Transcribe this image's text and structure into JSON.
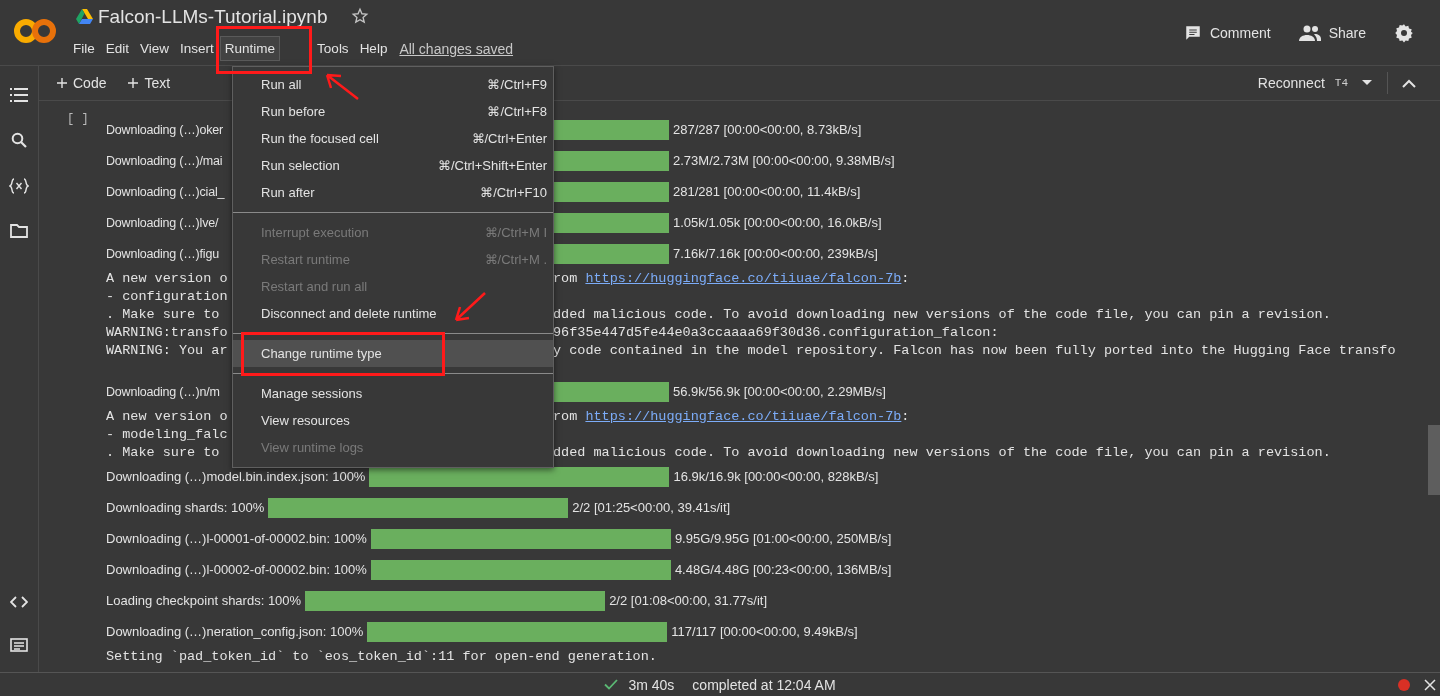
{
  "header": {
    "title": "Falcon-LLMs-Tutorial.ipynb",
    "save_status": "All changes saved",
    "actions": [
      {
        "kind": "comment",
        "label": "Comment"
      },
      {
        "kind": "share",
        "label": "Share"
      }
    ]
  },
  "menubar": [
    {
      "label": "File",
      "selected": false
    },
    {
      "label": "Edit",
      "selected": false
    },
    {
      "label": "View",
      "selected": false
    },
    {
      "label": "Insert",
      "selected": false
    },
    {
      "label": "Runtime",
      "selected": true
    },
    {
      "label": "Tools",
      "selected": false
    },
    {
      "label": "Help",
      "selected": false
    }
  ],
  "toolbar": {
    "add_buttons": [
      "Code",
      "Text"
    ],
    "runtime": {
      "label": "Reconnect",
      "accelerator": "T4"
    }
  },
  "cell": {
    "gutter": "[ ]",
    "lines": [
      {
        "kind": "progress",
        "under_menu": true,
        "label": "Downloading (…)oker",
        "level": 1,
        "reading": "287/287 [00:00<00:00, 8.73kB/s]"
      },
      {
        "kind": "progress",
        "under_menu": true,
        "label": "Downloading (…)/mai",
        "level": 1,
        "reading": "2.73M/2.73M [00:00<00:00, 9.38MB/s]"
      },
      {
        "kind": "progress",
        "under_menu": true,
        "label": "Downloading (…)cial_",
        "level": 1,
        "reading": "281/281 [00:00<00:00, 11.4kB/s]"
      },
      {
        "kind": "progress",
        "under_menu": true,
        "label": "Downloading (…)lve/",
        "level": 1,
        "reading": "1.05k/1.05k [00:00<00:00, 16.0kB/s]"
      },
      {
        "kind": "progress",
        "under_menu": true,
        "label": "Downloading (…)figu",
        "level": 1,
        "reading": "7.16k/7.16k [00:00<00:00, 239kB/s]"
      },
      {
        "kind": "text",
        "under_menu": true,
        "text": "A new version o",
        "right": [
          {
            "text": "rom "
          },
          {
            "text": "https://huggingface.co/tiiuae/falcon-7b",
            "kind": "link"
          },
          {
            "text": ":"
          }
        ]
      },
      {
        "kind": "text",
        "under_menu": true,
        "text": "- configuration"
      },
      {
        "kind": "text",
        "under_menu": true,
        "text": ". Make sure to",
        "right": [
          {
            "text": "dded malicious code. To avoid downloading new versions of the code file, you can pin a revision."
          }
        ]
      },
      {
        "kind": "text",
        "under_menu": true,
        "text": "WARNING:transfo",
        "right": [
          {
            "text": "96f35e447d5fe44e0a3ccaaaa69f30d36.configuration_falcon:"
          }
        ]
      },
      {
        "kind": "text",
        "under_menu": true,
        "text": "WARNING: You ar",
        "right": [
          {
            "text": "y code contained in the model repository. Falcon has now been fully ported into the Hugging Face transfo"
          }
        ]
      },
      {
        "kind": "blank"
      },
      {
        "kind": "progress",
        "under_menu": true,
        "label": "Downloading (…)n/m",
        "level": 1,
        "reading": "56.9k/56.9k [00:00<00:00, 2.29MB/s]"
      },
      {
        "kind": "text",
        "under_menu": true,
        "text": "A new version o",
        "right": [
          {
            "text": "rom "
          },
          {
            "text": "https://huggingface.co/tiiuae/falcon-7b",
            "kind": "link"
          },
          {
            "text": ":"
          }
        ]
      },
      {
        "kind": "text",
        "under_menu": true,
        "text": "- modeling_falc"
      },
      {
        "kind": "text",
        "under_menu": true,
        "text": ". Make sure to",
        "right": [
          {
            "text": "dded malicious code. To avoid downloading new versions of the code file, you can pin a revision."
          }
        ]
      },
      {
        "kind": "progress",
        "under_menu": false,
        "label": "Downloading (…)model.bin.index.json: 100%",
        "level": 1,
        "reading": "16.9k/16.9k [00:00<00:00, 828kB/s]"
      },
      {
        "kind": "progress",
        "under_menu": false,
        "label": "Downloading shards: 100%",
        "level": 1,
        "reading": "2/2 [01:25<00:00, 39.41s/it]"
      },
      {
        "kind": "progress",
        "under_menu": false,
        "label": "Downloading (…)l-00001-of-00002.bin: 100%",
        "level": 1,
        "reading": "9.95G/9.95G [01:00<00:00, 250MB/s]"
      },
      {
        "kind": "progress",
        "under_menu": false,
        "label": "Downloading (…)l-00002-of-00002.bin: 100%",
        "level": 1,
        "reading": "4.48G/4.48G [00:23<00:00, 136MB/s]"
      },
      {
        "kind": "progress",
        "under_menu": false,
        "label": "Loading checkpoint shards: 100%",
        "level": 1,
        "reading": "2/2 [01:08<00:00, 31.77s/it]"
      },
      {
        "kind": "progress",
        "under_menu": false,
        "label": "Downloading (…)neration_config.json: 100%",
        "level": 1,
        "reading": "117/117 [00:00<00:00, 9.49kB/s]"
      },
      {
        "kind": "text",
        "under_menu": false,
        "text": "Setting `pad_token_id` to `eos_token_id`:11 for open-end generation."
      }
    ]
  },
  "runtime_menu": [
    {
      "kind": "item",
      "label": "Run all",
      "shortcut": "⌘/Ctrl+F9",
      "disabled": false,
      "selected": false
    },
    {
      "kind": "item",
      "label": "Run before",
      "shortcut": "⌘/Ctrl+F8",
      "disabled": false,
      "selected": false
    },
    {
      "kind": "item",
      "label": "Run the focused cell",
      "shortcut": "⌘/Ctrl+Enter",
      "disabled": false,
      "selected": false
    },
    {
      "kind": "item",
      "label": "Run selection",
      "shortcut": "⌘/Ctrl+Shift+Enter",
      "disabled": false,
      "selected": false
    },
    {
      "kind": "item",
      "label": "Run after",
      "shortcut": "⌘/Ctrl+F10",
      "disabled": false,
      "selected": false
    },
    {
      "kind": "separator"
    },
    {
      "kind": "item",
      "label": "Interrupt execution",
      "shortcut": "⌘/Ctrl+M I",
      "disabled": true,
      "selected": false
    },
    {
      "kind": "item",
      "label": "Restart runtime",
      "shortcut": "⌘/Ctrl+M .",
      "disabled": true,
      "selected": false
    },
    {
      "kind": "item",
      "label": "Restart and run all",
      "disabled": true,
      "selected": false
    },
    {
      "kind": "item",
      "label": "Disconnect and delete runtime",
      "disabled": false,
      "selected": false
    },
    {
      "kind": "separator"
    },
    {
      "kind": "item",
      "label": "Change runtime type",
      "disabled": false,
      "selected": true
    },
    {
      "kind": "separator"
    },
    {
      "kind": "item",
      "label": "Manage sessions",
      "disabled": false,
      "selected": false
    },
    {
      "kind": "item",
      "label": "View resources",
      "disabled": false,
      "selected": false
    },
    {
      "kind": "item",
      "label": "View runtime logs",
      "disabled": true,
      "selected": false
    }
  ],
  "status_bar": {
    "elapsed": "3m 40s",
    "completed": "completed at 12:04 AM"
  }
}
